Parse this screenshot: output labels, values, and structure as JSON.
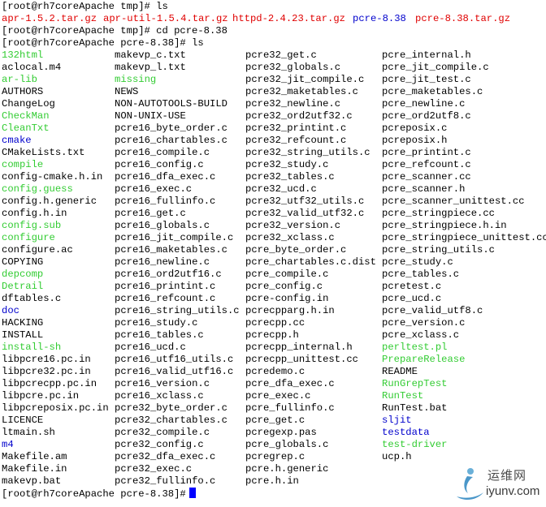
{
  "colors": {
    "text": "#000000",
    "archive": "#e00000",
    "directory": "#0000cc",
    "executable": "#33cc33",
    "cursor": "#0000ff",
    "background": "#ffffff"
  },
  "terminal": {
    "line1": "[root@rh7coreApache tmp]# ls",
    "line2_items": [
      {
        "text": "apr-1.5.2.tar.gz",
        "type": "archive"
      },
      {
        "text": "apr-util-1.5.4.tar.gz",
        "type": "archive"
      },
      {
        "text": "httpd-2.4.23.tar.gz",
        "type": "archive"
      },
      {
        "text": "pcre-8.38",
        "type": "directory"
      },
      {
        "text": "pcre-8.38.tar.gz",
        "type": "archive"
      }
    ],
    "line3": "[root@rh7coreApache tmp]# cd pcre-8.38",
    "line4": "[root@rh7coreApache pcre-8.38]# ls",
    "prompt_final": "[root@rh7coreApache pcre-8.38]#",
    "columns": [
      [
        {
          "n": "132html",
          "t": "x"
        },
        {
          "n": "aclocal.m4",
          "t": "f"
        },
        {
          "n": "ar-lib",
          "t": "x"
        },
        {
          "n": "AUTHORS",
          "t": "f"
        },
        {
          "n": "ChangeLog",
          "t": "f"
        },
        {
          "n": "CheckMan",
          "t": "x"
        },
        {
          "n": "CleanTxt",
          "t": "x"
        },
        {
          "n": "cmake",
          "t": "d"
        },
        {
          "n": "CMakeLists.txt",
          "t": "f"
        },
        {
          "n": "compile",
          "t": "x"
        },
        {
          "n": "config-cmake.h.in",
          "t": "f"
        },
        {
          "n": "config.guess",
          "t": "x"
        },
        {
          "n": "config.h.generic",
          "t": "f"
        },
        {
          "n": "config.h.in",
          "t": "f"
        },
        {
          "n": "config.sub",
          "t": "x"
        },
        {
          "n": "configure",
          "t": "x"
        },
        {
          "n": "configure.ac",
          "t": "f"
        },
        {
          "n": "COPYING",
          "t": "f"
        },
        {
          "n": "depcomp",
          "t": "x"
        },
        {
          "n": "Detrail",
          "t": "x"
        },
        {
          "n": "dftables.c",
          "t": "f"
        },
        {
          "n": "doc",
          "t": "d"
        },
        {
          "n": "HACKING",
          "t": "f"
        },
        {
          "n": "INSTALL",
          "t": "f"
        },
        {
          "n": "install-sh",
          "t": "x"
        },
        {
          "n": "libpcre16.pc.in",
          "t": "f"
        },
        {
          "n": "libpcre32.pc.in",
          "t": "f"
        },
        {
          "n": "libpcrecpp.pc.in",
          "t": "f"
        },
        {
          "n": "libpcre.pc.in",
          "t": "f"
        },
        {
          "n": "libpcreposix.pc.in",
          "t": "f"
        },
        {
          "n": "LICENCE",
          "t": "f"
        },
        {
          "n": "ltmain.sh",
          "t": "f"
        },
        {
          "n": "m4",
          "t": "d"
        },
        {
          "n": "Makefile.am",
          "t": "f"
        },
        {
          "n": "Makefile.in",
          "t": "f"
        },
        {
          "n": "makevp.bat",
          "t": "f"
        }
      ],
      [
        {
          "n": "makevp_c.txt",
          "t": "f"
        },
        {
          "n": "makevp_l.txt",
          "t": "f"
        },
        {
          "n": "missing",
          "t": "x"
        },
        {
          "n": "NEWS",
          "t": "f"
        },
        {
          "n": "NON-AUTOTOOLS-BUILD",
          "t": "f"
        },
        {
          "n": "NON-UNIX-USE",
          "t": "f"
        },
        {
          "n": "pcre16_byte_order.c",
          "t": "f"
        },
        {
          "n": "pcre16_chartables.c",
          "t": "f"
        },
        {
          "n": "pcre16_compile.c",
          "t": "f"
        },
        {
          "n": "pcre16_config.c",
          "t": "f"
        },
        {
          "n": "pcre16_dfa_exec.c",
          "t": "f"
        },
        {
          "n": "pcre16_exec.c",
          "t": "f"
        },
        {
          "n": "pcre16_fullinfo.c",
          "t": "f"
        },
        {
          "n": "pcre16_get.c",
          "t": "f"
        },
        {
          "n": "pcre16_globals.c",
          "t": "f"
        },
        {
          "n": "pcre16_jit_compile.c",
          "t": "f"
        },
        {
          "n": "pcre16_maketables.c",
          "t": "f"
        },
        {
          "n": "pcre16_newline.c",
          "t": "f"
        },
        {
          "n": "pcre16_ord2utf16.c",
          "t": "f"
        },
        {
          "n": "pcre16_printint.c",
          "t": "f"
        },
        {
          "n": "pcre16_refcount.c",
          "t": "f"
        },
        {
          "n": "pcre16_string_utils.c",
          "t": "f"
        },
        {
          "n": "pcre16_study.c",
          "t": "f"
        },
        {
          "n": "pcre16_tables.c",
          "t": "f"
        },
        {
          "n": "pcre16_ucd.c",
          "t": "f"
        },
        {
          "n": "pcre16_utf16_utils.c",
          "t": "f"
        },
        {
          "n": "pcre16_valid_utf16.c",
          "t": "f"
        },
        {
          "n": "pcre16_version.c",
          "t": "f"
        },
        {
          "n": "pcre16_xclass.c",
          "t": "f"
        },
        {
          "n": "pcre32_byte_order.c",
          "t": "f"
        },
        {
          "n": "pcre32_chartables.c",
          "t": "f"
        },
        {
          "n": "pcre32_compile.c",
          "t": "f"
        },
        {
          "n": "pcre32_config.c",
          "t": "f"
        },
        {
          "n": "pcre32_dfa_exec.c",
          "t": "f"
        },
        {
          "n": "pcre32_exec.c",
          "t": "f"
        },
        {
          "n": "pcre32_fullinfo.c",
          "t": "f"
        }
      ],
      [
        {
          "n": "pcre32_get.c",
          "t": "f"
        },
        {
          "n": "pcre32_globals.c",
          "t": "f"
        },
        {
          "n": "pcre32_jit_compile.c",
          "t": "f"
        },
        {
          "n": "pcre32_maketables.c",
          "t": "f"
        },
        {
          "n": "pcre32_newline.c",
          "t": "f"
        },
        {
          "n": "pcre32_ord2utf32.c",
          "t": "f"
        },
        {
          "n": "pcre32_printint.c",
          "t": "f"
        },
        {
          "n": "pcre32_refcount.c",
          "t": "f"
        },
        {
          "n": "pcre32_string_utils.c",
          "t": "f"
        },
        {
          "n": "pcre32_study.c",
          "t": "f"
        },
        {
          "n": "pcre32_tables.c",
          "t": "f"
        },
        {
          "n": "pcre32_ucd.c",
          "t": "f"
        },
        {
          "n": "pcre32_utf32_utils.c",
          "t": "f"
        },
        {
          "n": "pcre32_valid_utf32.c",
          "t": "f"
        },
        {
          "n": "pcre32_version.c",
          "t": "f"
        },
        {
          "n": "pcre32_xclass.c",
          "t": "f"
        },
        {
          "n": "pcre_byte_order.c",
          "t": "f"
        },
        {
          "n": "pcre_chartables.c.dist",
          "t": "f"
        },
        {
          "n": "pcre_compile.c",
          "t": "f"
        },
        {
          "n": "pcre_config.c",
          "t": "f"
        },
        {
          "n": "pcre-config.in",
          "t": "f"
        },
        {
          "n": "pcrecpparg.h.in",
          "t": "f"
        },
        {
          "n": "pcrecpp.cc",
          "t": "f"
        },
        {
          "n": "pcrecpp.h",
          "t": "f"
        },
        {
          "n": "pcrecpp_internal.h",
          "t": "f"
        },
        {
          "n": "pcrecpp_unittest.cc",
          "t": "f"
        },
        {
          "n": "pcredemo.c",
          "t": "f"
        },
        {
          "n": "pcre_dfa_exec.c",
          "t": "f"
        },
        {
          "n": "pcre_exec.c",
          "t": "f"
        },
        {
          "n": "pcre_fullinfo.c",
          "t": "f"
        },
        {
          "n": "pcre_get.c",
          "t": "f"
        },
        {
          "n": "pcregexp.pas",
          "t": "f"
        },
        {
          "n": "pcre_globals.c",
          "t": "f"
        },
        {
          "n": "pcregrep.c",
          "t": "f"
        },
        {
          "n": "pcre.h.generic",
          "t": "f"
        },
        {
          "n": "pcre.h.in",
          "t": "f"
        }
      ],
      [
        {
          "n": "pcre_internal.h",
          "t": "f"
        },
        {
          "n": "pcre_jit_compile.c",
          "t": "f"
        },
        {
          "n": "pcre_jit_test.c",
          "t": "f"
        },
        {
          "n": "pcre_maketables.c",
          "t": "f"
        },
        {
          "n": "pcre_newline.c",
          "t": "f"
        },
        {
          "n": "pcre_ord2utf8.c",
          "t": "f"
        },
        {
          "n": "pcreposix.c",
          "t": "f"
        },
        {
          "n": "pcreposix.h",
          "t": "f"
        },
        {
          "n": "pcre_printint.c",
          "t": "f"
        },
        {
          "n": "pcre_refcount.c",
          "t": "f"
        },
        {
          "n": "pcre_scanner.cc",
          "t": "f"
        },
        {
          "n": "pcre_scanner.h",
          "t": "f"
        },
        {
          "n": "pcre_scanner_unittest.cc",
          "t": "f"
        },
        {
          "n": "pcre_stringpiece.cc",
          "t": "f"
        },
        {
          "n": "pcre_stringpiece.h.in",
          "t": "f"
        },
        {
          "n": "pcre_stringpiece_unittest.cc",
          "t": "f"
        },
        {
          "n": "pcre_string_utils.c",
          "t": "f"
        },
        {
          "n": "pcre_study.c",
          "t": "f"
        },
        {
          "n": "pcre_tables.c",
          "t": "f"
        },
        {
          "n": "pcretest.c",
          "t": "f"
        },
        {
          "n": "pcre_ucd.c",
          "t": "f"
        },
        {
          "n": "pcre_valid_utf8.c",
          "t": "f"
        },
        {
          "n": "pcre_version.c",
          "t": "f"
        },
        {
          "n": "pcre_xclass.c",
          "t": "f"
        },
        {
          "n": "perltest.pl",
          "t": "x"
        },
        {
          "n": "PrepareRelease",
          "t": "x"
        },
        {
          "n": "README",
          "t": "f"
        },
        {
          "n": "RunGrepTest",
          "t": "x"
        },
        {
          "n": "RunTest",
          "t": "x"
        },
        {
          "n": "RunTest.bat",
          "t": "f"
        },
        {
          "n": "sljit",
          "t": "d"
        },
        {
          "n": "testdata",
          "t": "d"
        },
        {
          "n": "test-driver",
          "t": "x"
        },
        {
          "n": "ucp.h",
          "t": "f"
        }
      ]
    ]
  },
  "watermark": {
    "cn": "运维网",
    "en": "iyunv.com",
    "icon": "person-swoosh-logo-icon"
  }
}
